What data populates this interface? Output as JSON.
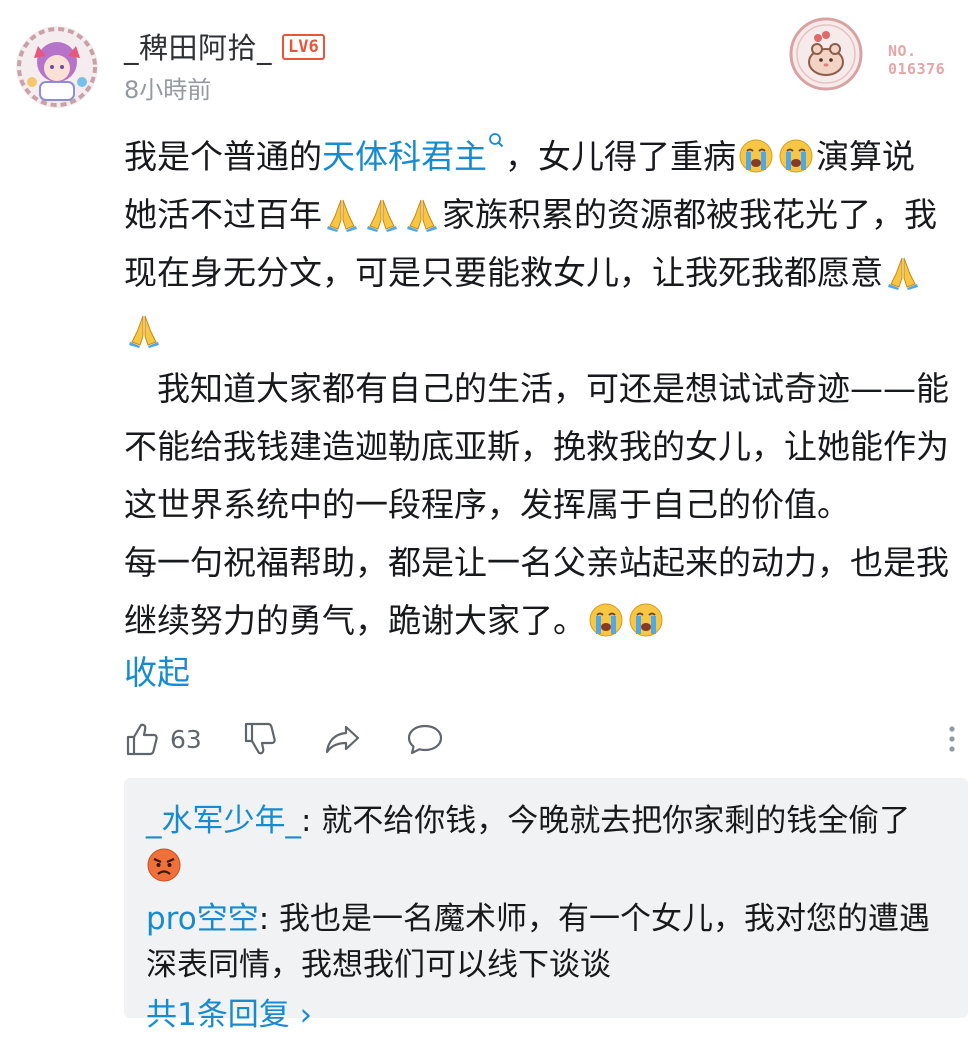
{
  "comment": {
    "author": {
      "name": "_稗田阿拾_",
      "level": "LV6"
    },
    "time": "8小時前",
    "fan_badge": {
      "label": "NO.",
      "number": "016376"
    },
    "body": {
      "p1_before_link": "我是个普通的",
      "link_text": "天体科君主",
      "p1_after_link": "，女儿得了重病",
      "p1_end": "演算说",
      "l2_a": "她活不过百年",
      "l2_b": "家族积累的资源都被我花光了，我",
      "l3": "现在身无分文，可是只要能救女儿，让我死我都愿意",
      "l5": "我知道大家都有自己的生活，可还是想试试奇迹——能",
      "l6": "不能给我钱建造迦勒底亚斯，挽救我的女儿，让她能作为",
      "l7": "这世界系统中的一段程序，发挥属于自己的价值。",
      "l8": "每一句祝福帮助，都是让一名父亲站起来的动力，也是我",
      "l9": "继续努力的勇气，跪谢大家了。"
    },
    "collapse_label": "收起",
    "like_count": "63"
  },
  "icons": {
    "sob": "loudly-crying-face-emoji",
    "pray": "folded-hands-emoji",
    "angry": "angry-face-emoji",
    "like": "thumbs-up-icon",
    "dislike": "thumbs-down-icon",
    "share": "share-icon",
    "reply": "comment-icon",
    "more": "more-vertical-icon"
  },
  "replies": [
    {
      "user": "_水军少年_",
      "sep": ": ",
      "text": "就不给你钱，今晚就去把你家剩的钱全偷了"
    },
    {
      "user": "pro空空",
      "sep": ": ",
      "text": "我也是一名魔术师，有一个女儿，我对您的遭遇",
      "text_cont": "深表同情，我想我们可以线下谈谈"
    }
  ],
  "more_replies": "共1条回复 ›",
  "colors": {
    "link": "#178bcf",
    "text": "#18191c",
    "secondary": "#9499a0",
    "level": "#e9553b",
    "reply_bg": "#f1f2f3"
  }
}
